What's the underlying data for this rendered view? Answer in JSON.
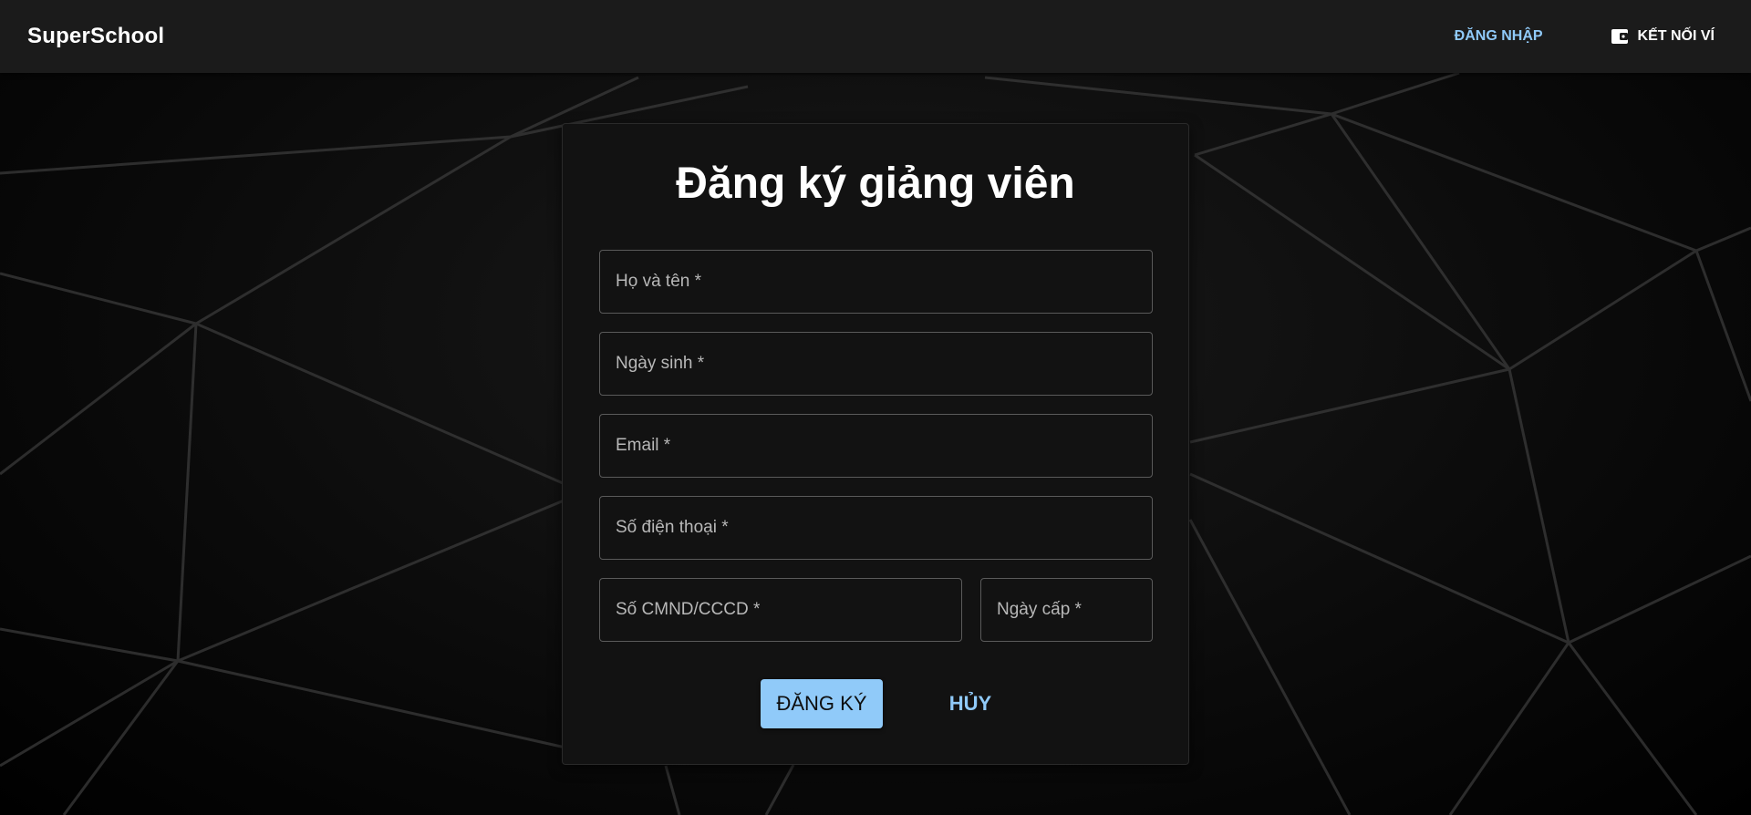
{
  "appbar": {
    "brand": "SuperSchool",
    "login_label": "ĐĂNG NHẬP",
    "wallet_label": "KẾT NỐI VÍ"
  },
  "form": {
    "title": "Đăng ký giảng viên",
    "fields": [
      {
        "placeholder": "Họ và tên *",
        "value": ""
      },
      {
        "placeholder": "Ngày sinh *",
        "value": ""
      },
      {
        "placeholder": "Email *",
        "value": ""
      },
      {
        "placeholder": "Số điện thoại *",
        "value": ""
      },
      {
        "placeholder": "Số CMND/CCCD *",
        "value": ""
      },
      {
        "placeholder": "Ngày cấp *",
        "value": ""
      }
    ],
    "submit_label": "ĐĂNG KÝ",
    "cancel_label": "HỦY"
  },
  "colors": {
    "accent": "#90caf9",
    "appbar_bg": "#1b1b1b",
    "card_bg": "#121212",
    "page_bg": "#000000"
  },
  "icons": {
    "wallet": "wallet-icon",
    "background": "network-mesh"
  }
}
